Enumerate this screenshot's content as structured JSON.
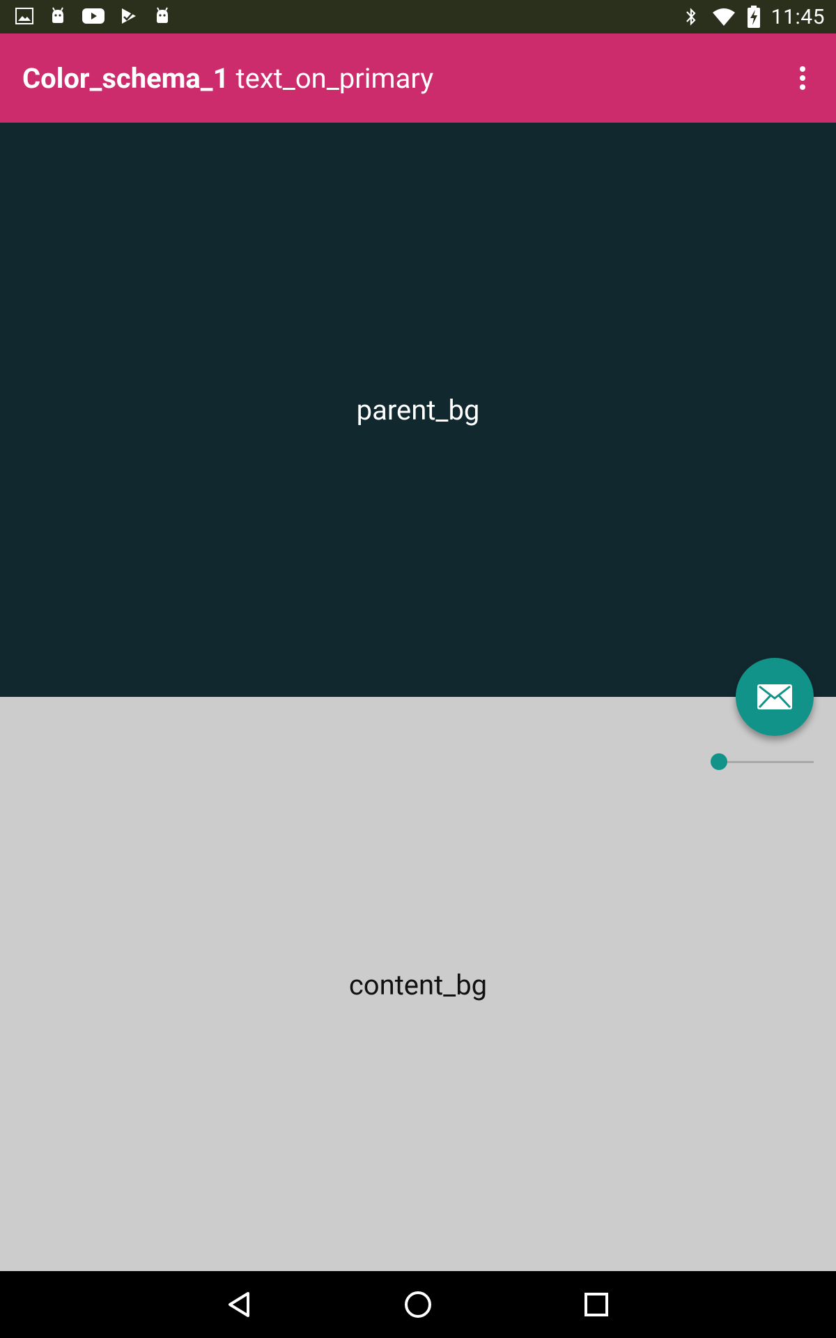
{
  "status_bar": {
    "time": "11:45",
    "left_icons": [
      "image-icon",
      "android-icon",
      "youtube-icon",
      "store-icon",
      "android-icon"
    ],
    "right_icons": [
      "bluetooth-icon",
      "wifi-icon",
      "battery-charging-icon"
    ]
  },
  "app_bar": {
    "title_bold": "Color_schema_1",
    "title_regular": "text_on_primary",
    "background": "#cc2c6c",
    "menu_icon": "more-vert-icon"
  },
  "parent_section": {
    "label": "parent_bg",
    "background": "#12282f"
  },
  "content_section": {
    "label": "content_bg",
    "background": "#cccccc"
  },
  "fab": {
    "icon": "mail-icon",
    "color": "#129389"
  },
  "slider": {
    "value": 0.0,
    "accent": "#129389"
  },
  "nav_bar": {
    "buttons": [
      "back-icon",
      "home-icon",
      "recents-icon"
    ]
  }
}
